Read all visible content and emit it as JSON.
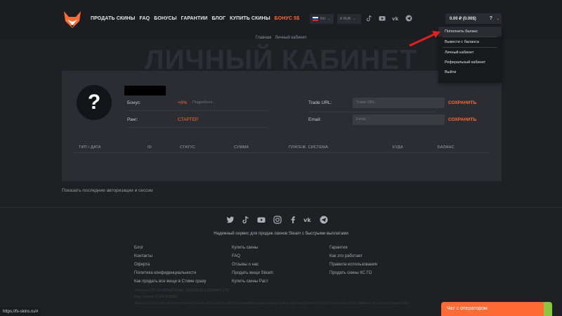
{
  "nav": {
    "items": [
      "ПРОДАТЬ СКИНЫ",
      "FAQ",
      "БОНУСЫ",
      "ГАРАНТИИ",
      "БЛОГ",
      "КУПИТЬ СКИНЫ"
    ],
    "bonus": "БОНУС 5$"
  },
  "lang_select": {
    "value": "RU"
  },
  "currency_select": {
    "value": "₽ RUB"
  },
  "balance": {
    "value": "0.00 ₽ (0.00$)",
    "help": "?"
  },
  "dropdown": {
    "items": [
      "Пополнить баланс",
      "Вывести с баланса",
      "Личный кабинет",
      "Реферальный кабинет",
      "Выйти"
    ]
  },
  "breadcrumb": {
    "home": "Главная",
    "current": "Личный кабинет"
  },
  "page_title": "ЛИЧНЫЙ КАБИНЕТ",
  "profile": {
    "avatar_glyph": "?",
    "bonus_label": "Бонус:",
    "bonus_value": "+0%",
    "bonus_more": "Подробнее...",
    "rank_label": "Ранг:",
    "rank_value": "СТАРТЕР",
    "trade_url_label": "Trade URL:",
    "trade_url_placeholder": "Trade URL",
    "email_label": "Email:",
    "email_placeholder": "Email",
    "save_label": "СОХРАНИТЬ"
  },
  "table": {
    "headers": [
      "ТИП / ДАТА",
      "ID",
      "СТАТУС",
      "СУММА",
      "ПЛАТЕЖ. СИСТЕМА",
      "КУДА",
      "БАЛАНС"
    ]
  },
  "sessions_link": "Показать последние авторизации и сессии",
  "footer": {
    "tagline": "Надежный сервис для продаж скинов Steam с быстрыми выплатами",
    "col1": [
      "Блог",
      "Контакты",
      "Оферта",
      "Политика конфиденциальности",
      "Как продать все вещи в Стиме сразу"
    ],
    "col2": [
      "Купить скины",
      "FAQ",
      "Отзывы о нас",
      "Продать вещи Steam",
      "Купить скины Раст"
    ],
    "col3": [
      "Гарантия",
      "Как это работает",
      "Правила использования",
      "Продать скины КС ГО"
    ],
    "legal1": "SkinsFox LTD INTERNATIONAL BUSINESS COMPANY LTD",
    "legal2": "Reg. number 2-102-243823",
    "legal3": "SkinsFox is NOT AFFILIATED WITH VALVE CORP. DOTA AND CS ARE TRADEMARKS AND/OR REGISTERED AND PATENT MATTERS OF THE RESPECTIVE OWNERS. ALL RIGHTS RESERVED"
  },
  "status_url": "https://fs-skins.ru/#",
  "chat_label": "Чат с оператором",
  "colors": {
    "accent": "#ff6b35",
    "background": "#1f2024",
    "card": "#2c2d33"
  }
}
